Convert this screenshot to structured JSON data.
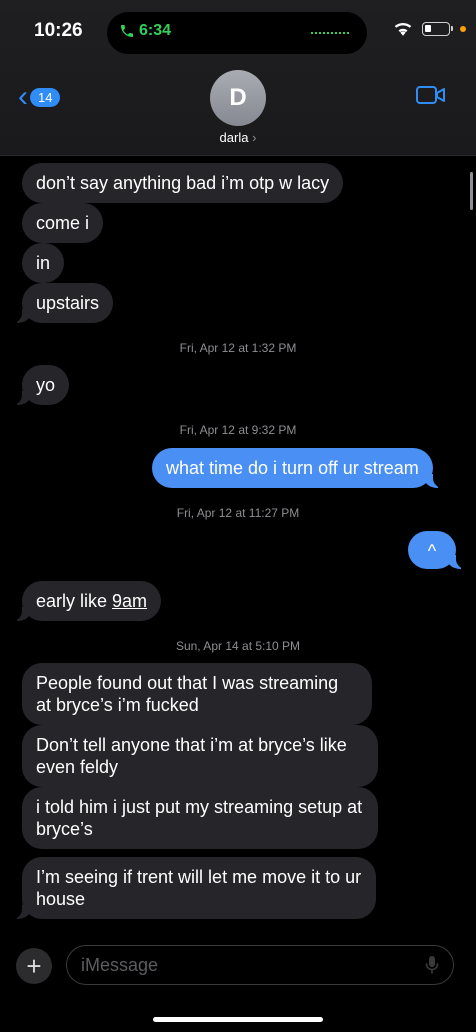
{
  "status": {
    "time": "10:26",
    "call_time": "6:34",
    "icons": [
      "wifi-icon",
      "battery-icon",
      "phone-icon"
    ]
  },
  "header": {
    "back_badge": "14",
    "avatar_initial": "D",
    "contact_name": "darla",
    "contact_chevron": "›"
  },
  "messages": {
    "m1": "don’t say anything bad i’m otp w lacy",
    "m2": "come i",
    "m3": "in",
    "m4": "upstairs",
    "ts1_date": "Fri, Apr 12",
    "ts1_at": "at 1:32 PM",
    "m5": "yo",
    "ts2_date": "Fri, Apr 12",
    "ts2_at": "at 9:32 PM",
    "m6": "what time do i turn off ur stream",
    "ts3_date": "Fri, Apr 12",
    "ts3_at": "at 11:27 PM",
    "m7": "^",
    "m8_prefix": "early like ",
    "m8_link": "9am",
    "ts4_date": "Sun, Apr 14",
    "ts4_at": "at 5:10 PM",
    "m9": "People found out that I was streaming at bryce’s i’m fucked",
    "m10": "Don’t tell anyone that i’m at bryce’s like even feldy",
    "m11": "i told him i just put my streaming setup at bryce’s",
    "m12": "I’m seeing if trent will let me move it to ur house"
  },
  "composer": {
    "placeholder": "iMessage",
    "plus": "+"
  },
  "colors": {
    "sent_bubble": "#4a90f4",
    "received_bubble": "#26252a",
    "accent": "#2f8df5",
    "call_green": "#33d058"
  }
}
